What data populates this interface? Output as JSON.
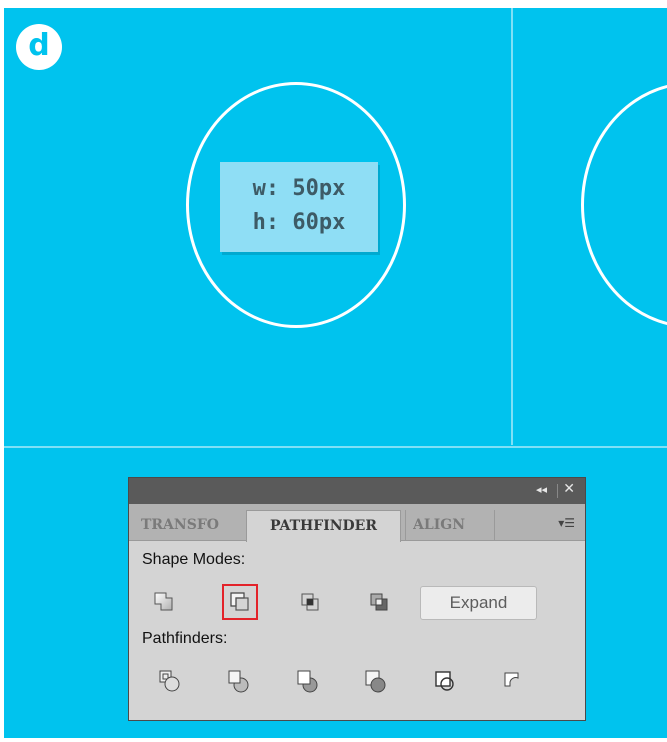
{
  "step_badge": "d",
  "dimensions": {
    "width": "w: 50px",
    "height": "h: 60px"
  },
  "panel": {
    "tabs": [
      {
        "label": "TRANSFO"
      },
      {
        "label": "PATHFINDER",
        "active": true
      },
      {
        "label": "ALIGN"
      }
    ],
    "title_controls": {
      "collapse": "◂◂",
      "close": "✕",
      "menu": "▾☰"
    },
    "shape_modes_label": "Shape Modes:",
    "shape_modes": [
      {
        "name": "unite-icon"
      },
      {
        "name": "minus-front-icon",
        "selected": true
      },
      {
        "name": "intersect-icon"
      },
      {
        "name": "exclude-icon"
      }
    ],
    "expand_label": "Expand",
    "pathfinders_label": "Pathfinders:",
    "pathfinders": [
      {
        "name": "divide-icon"
      },
      {
        "name": "trim-icon"
      },
      {
        "name": "merge-icon"
      },
      {
        "name": "crop-icon"
      },
      {
        "name": "outline-icon"
      },
      {
        "name": "minus-back-icon"
      }
    ]
  },
  "colors": {
    "canvas": "#00c3ee",
    "selection": "#e3232a",
    "panel": "#d4d4d4"
  }
}
